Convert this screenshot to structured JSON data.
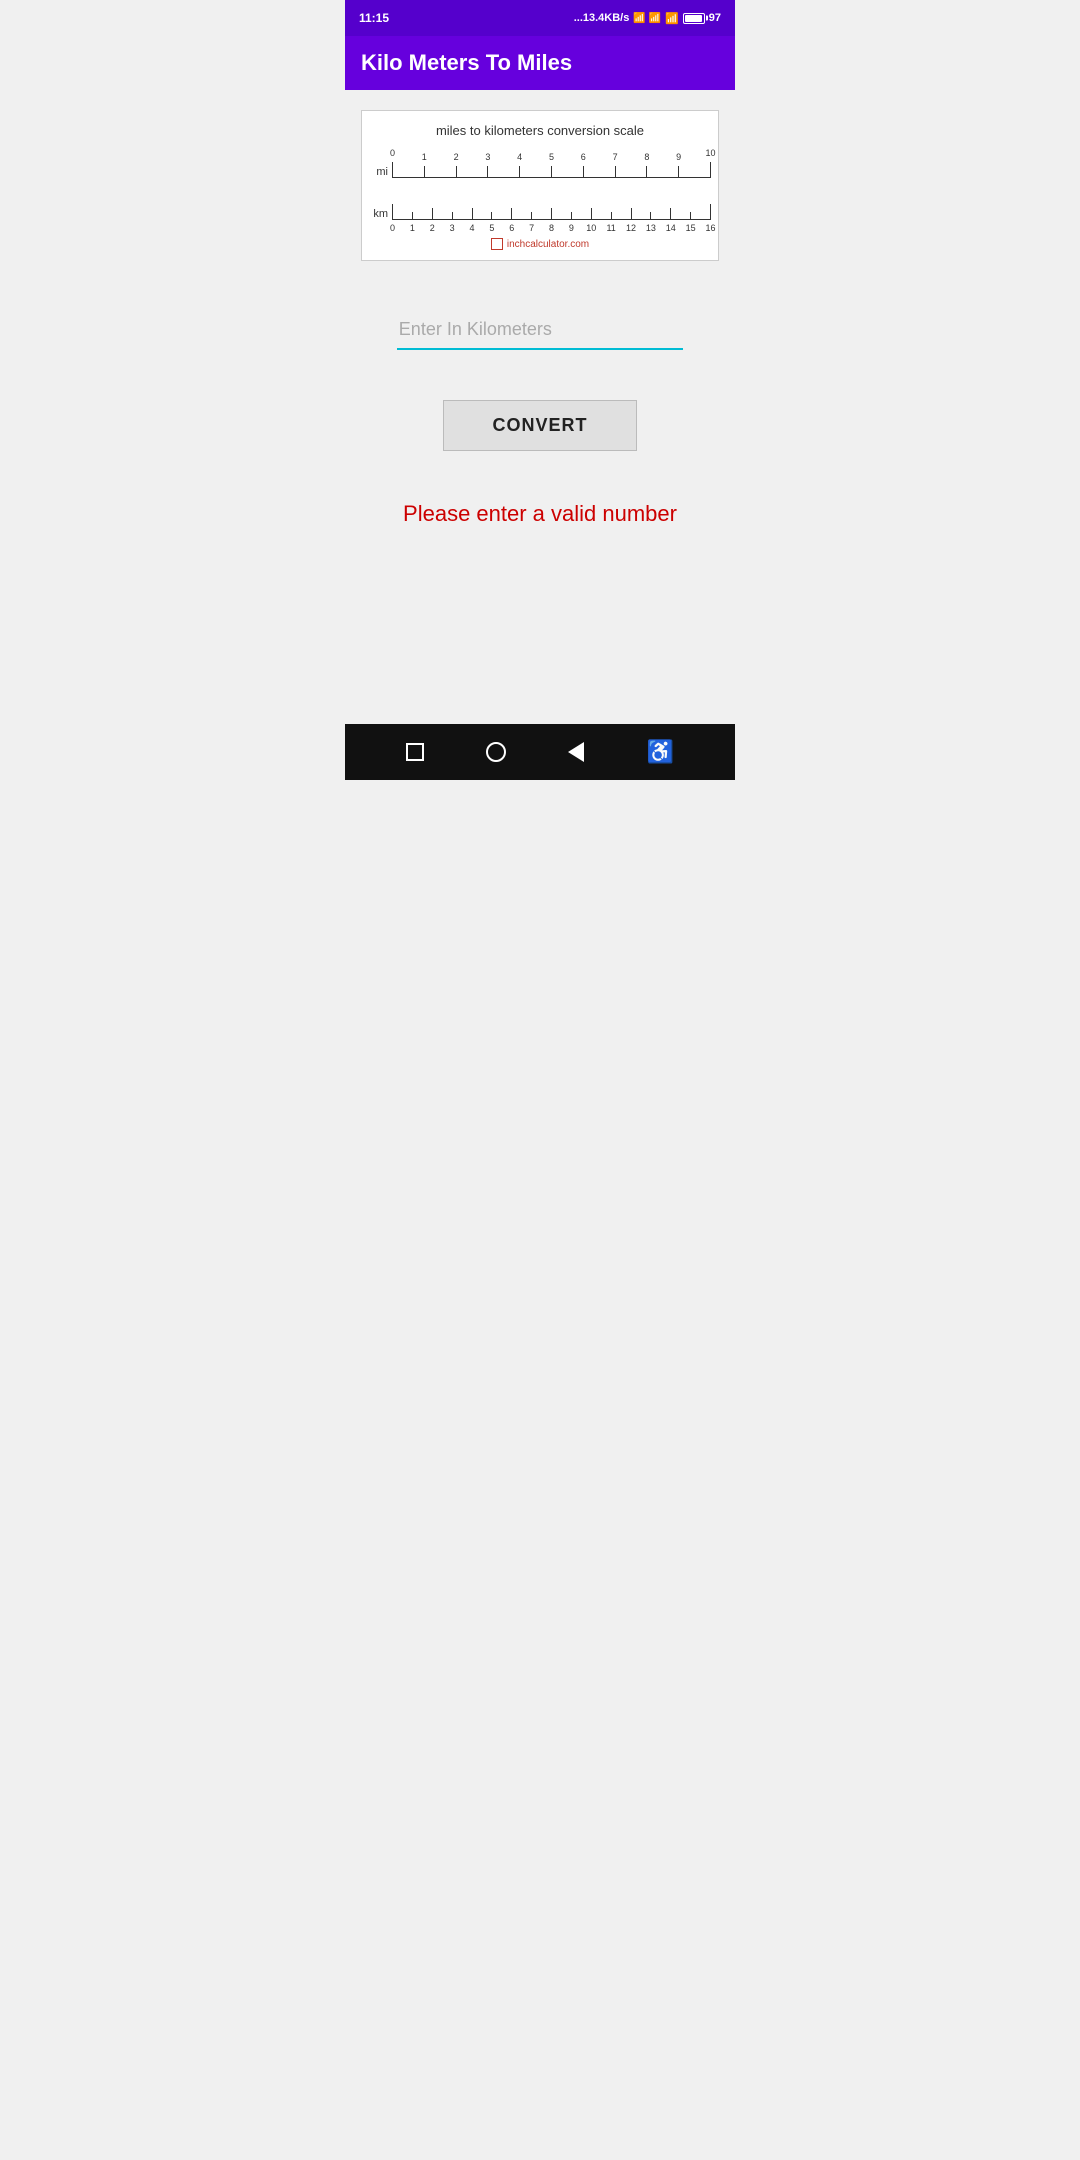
{
  "status_bar": {
    "time": "11:15",
    "network": "...13.4KB/s",
    "battery": "97"
  },
  "app_bar": {
    "title": "Kilo Meters To Miles"
  },
  "scale": {
    "title": "miles to kilometers conversion scale",
    "watermark": "inchcalculator.com",
    "miles_label": "mi",
    "km_label": "km",
    "miles_ticks": [
      "0",
      "1",
      "2",
      "3",
      "4",
      "5",
      "6",
      "7",
      "8",
      "9",
      "10"
    ],
    "km_ticks": [
      "0",
      "2",
      "4",
      "6",
      "8",
      "10",
      "12",
      "14",
      "16"
    ]
  },
  "input": {
    "placeholder": "Enter In Kilometers",
    "value": ""
  },
  "convert_button": {
    "label": "CONVERT"
  },
  "error_message": {
    "text": "Please enter a valid number"
  },
  "bottom_nav": {
    "buttons": [
      "square",
      "circle",
      "back",
      "accessibility"
    ]
  }
}
